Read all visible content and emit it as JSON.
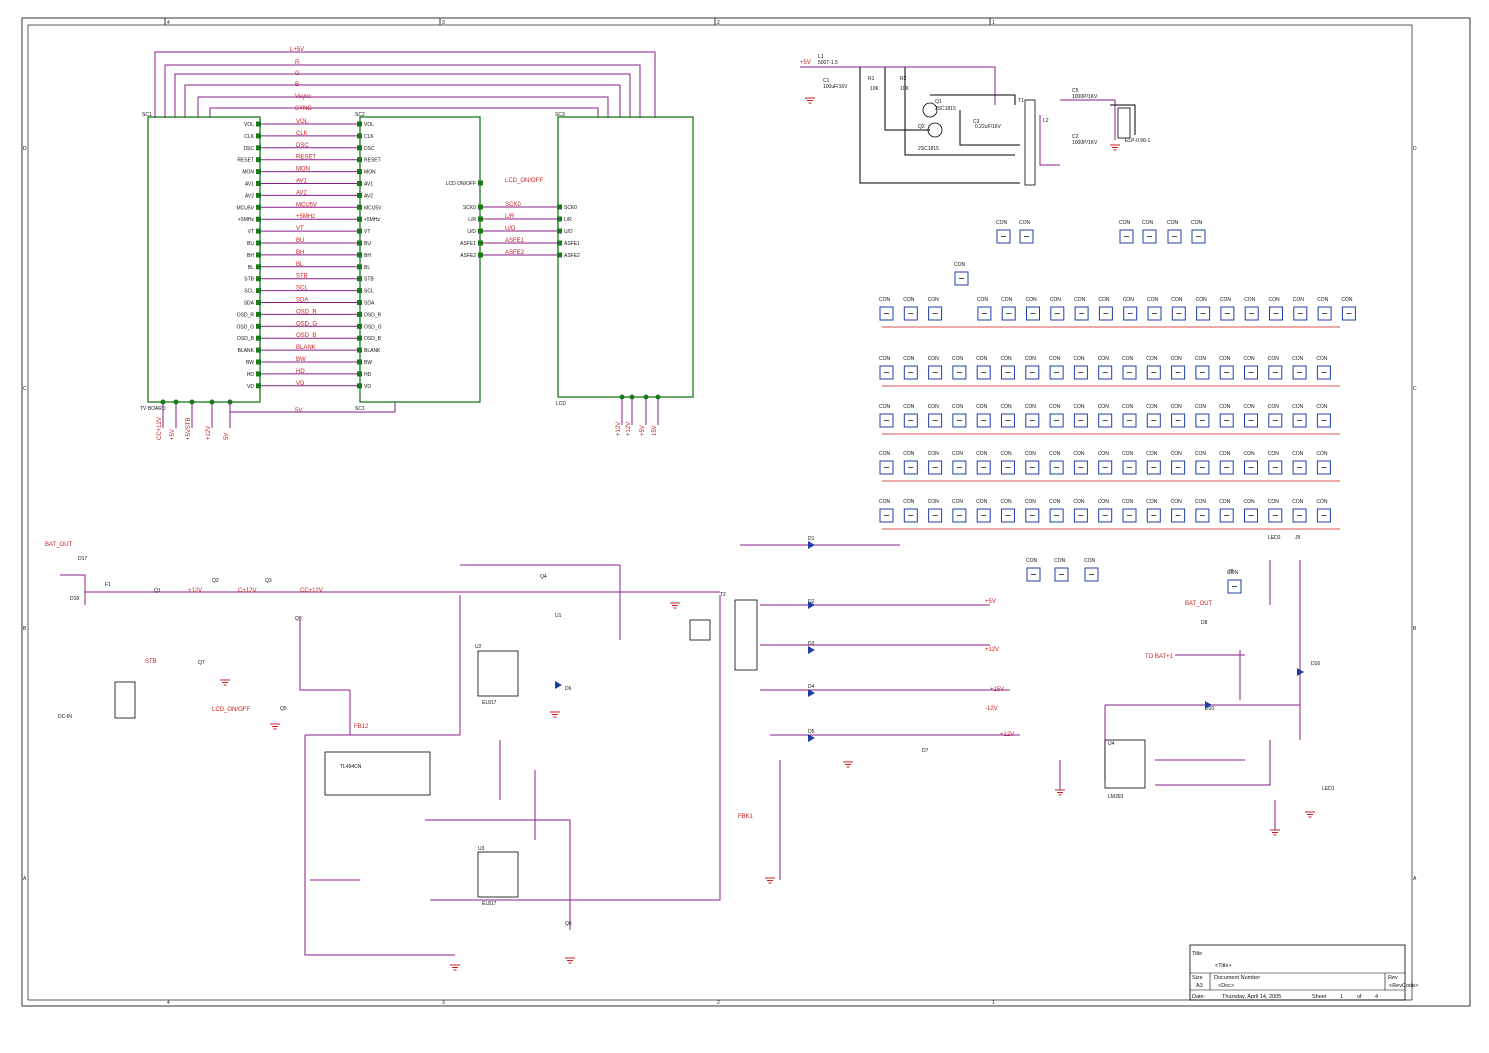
{
  "frame": {
    "top_ticks": [
      "4",
      "3",
      "2",
      "1"
    ],
    "side_ticks": [
      "D",
      "C",
      "B",
      "A"
    ]
  },
  "top_bus": {
    "nets": [
      "L+5V",
      "R",
      "G",
      "B",
      "Vsync",
      "SYNC"
    ]
  },
  "tv_board": {
    "ref": "SC1",
    "name": "TV BOARD",
    "left_pins": [
      "VOL",
      "CLK",
      "DSC",
      "RESET",
      "MON",
      "AV1",
      "AV2",
      "MCU5V",
      "+5MHz",
      "VT",
      "BU",
      "BH",
      "BL",
      "STB",
      "SCL",
      "SDA",
      "OSD_R",
      "OSD_G",
      "OSD_B",
      "BLANK",
      "BW",
      "HD",
      "VD"
    ],
    "bottom_pins": [
      "CC+12V",
      "+5V",
      "+5VSTB",
      "+12V",
      "5V"
    ]
  },
  "mid_board": {
    "ref": "SC2",
    "name": "SC1",
    "nets": [
      "VOL",
      "CLK",
      "DSC",
      "RESET",
      "MON",
      "AV1",
      "AV2",
      "MCU5V",
      "+5MHz",
      "VT",
      "BU",
      "BH",
      "BL",
      "STB",
      "SCL",
      "SDA",
      "OSD_R",
      "OSD_G",
      "OSD_B",
      "BLANK",
      "BW",
      "HD",
      "VD"
    ],
    "bottom_net": "5V",
    "side_nets": [
      "LCD_ON/OFF",
      "SCK0",
      "L/R",
      "U/D",
      "ASFE1",
      "ASFE2"
    ],
    "side_pins": [
      "LCD ON/OFF",
      "SCK0",
      "L/R",
      "U/D",
      "ASFE1",
      "ASFE2"
    ]
  },
  "lcd_board": {
    "ref": "SC3",
    "name": "LCD",
    "bottom_nets": [
      "+12V",
      "+12V",
      "+5V",
      "15V"
    ]
  },
  "power_supply": {
    "labels": [
      "L1",
      "C1",
      "R1",
      "R2",
      "Q1",
      "Q2",
      "C3",
      "T1",
      "C5",
      "L2",
      "C2",
      "ELP-0.96-1"
    ],
    "values": [
      "500T-1.5",
      "100uF/16V",
      "10K",
      "10K",
      "2SC1815",
      "2SC1815",
      "0.22uF/16V",
      "1000P/1KV",
      "1000P/1KV"
    ],
    "input_net": "+5V"
  },
  "connectors": {
    "unit": "CON",
    "ids_row1": [
      "J5",
      "J6",
      "J10",
      "J12",
      "J13",
      "J14",
      "J15",
      "J16",
      "J17",
      "J18",
      "J19",
      "J20",
      "J21",
      "J22",
      "J23",
      "J24",
      "J25",
      "J26",
      "J27"
    ],
    "misc": [
      "J1",
      "J2",
      "J3",
      "J4",
      "J7",
      "J8",
      "J9",
      "J11",
      "J100",
      "J101",
      "J102"
    ]
  },
  "psu_bottom": {
    "nets": [
      "BAT_OUT",
      "CC+12V",
      "C+12V",
      "+12V",
      "STB",
      "LCD_ON/OFF",
      "FB12",
      "+5V",
      "+12V",
      "+15V",
      "+12V",
      "-12V",
      "BAT_OUT",
      "TO BAT+1",
      "FBK1"
    ],
    "parts": [
      "D17",
      "D18",
      "F1",
      "Q1",
      "Q2",
      "Q3",
      "Q4",
      "Q5",
      "Q6",
      "Q7",
      "Q8",
      "U1",
      "U2",
      "U3",
      "U4",
      "T2",
      "D1",
      "D2",
      "D3",
      "D4",
      "D5",
      "D6",
      "D7",
      "D8",
      "D10",
      "D16",
      "LED1",
      "LED2",
      "J8",
      "J9"
    ],
    "chip_u1": "TL494CN",
    "chip_u2": "EL817",
    "chip_u3": "EL817",
    "chip_u4": "LM393",
    "jack": "DC-IN"
  },
  "title_block": {
    "title_label": "Title",
    "title_value": "<Title>",
    "size_label": "Size",
    "size_value": "A3",
    "doc_label": "Document Number",
    "doc_value": "<Doc>",
    "rev_label": "Rev",
    "rev_value": "<RevCode>",
    "date_label": "Date:",
    "date_value": "Thursday, April 14, 2005",
    "sheet_label": "Sheet",
    "sheet_value": "1",
    "of_label": "of",
    "of_value": "4"
  },
  "colors": {
    "wire": "#8b1e8b",
    "net": "#c81e1e",
    "board": "#1a7a1a",
    "connector": "#1f3fa8"
  }
}
